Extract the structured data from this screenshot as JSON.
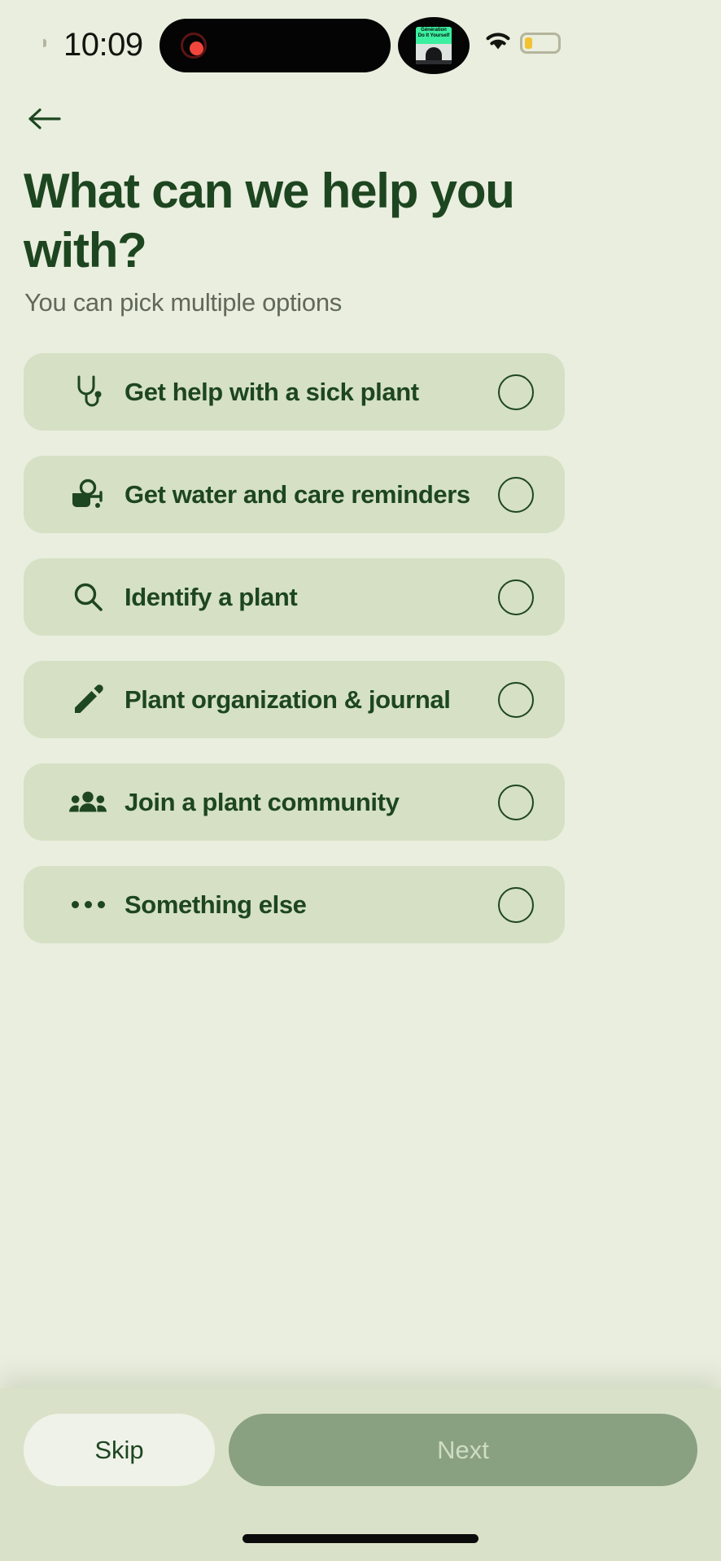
{
  "status_bar": {
    "time": "10:09",
    "recording_indicator": "record-dot",
    "podcast_title_line1": "Génération",
    "podcast_title_line2": "Do It Yourself",
    "wifi": "wifi-icon",
    "battery": "battery-low-icon"
  },
  "nav": {
    "back_label": "Back"
  },
  "header": {
    "title": "What can we help you with?",
    "subtitle": "You can pick multiple options"
  },
  "options": [
    {
      "label": "Get help with a sick plant",
      "icon": "stethoscope-icon",
      "selected": false
    },
    {
      "label": "Get water and care reminders",
      "icon": "watering-can-icon",
      "selected": false
    },
    {
      "label": "Identify a plant",
      "icon": "search-icon",
      "selected": false
    },
    {
      "label": "Plant organization & journal",
      "icon": "pencil-icon",
      "selected": false
    },
    {
      "label": "Join a plant community",
      "icon": "people-group-icon",
      "selected": false
    },
    {
      "label": "Something else",
      "icon": "ellipsis-icon",
      "selected": false
    }
  ],
  "footer": {
    "skip_label": "Skip",
    "next_label": "Next"
  },
  "colors": {
    "background": "#e9eede",
    "card": "#d5e0c4",
    "accent_dark_green": "#1d4620",
    "muted_text": "#61695c",
    "next_button": "#89a181",
    "skip_button": "#eff2e8",
    "bottom_bar": "#d9e2c8"
  }
}
